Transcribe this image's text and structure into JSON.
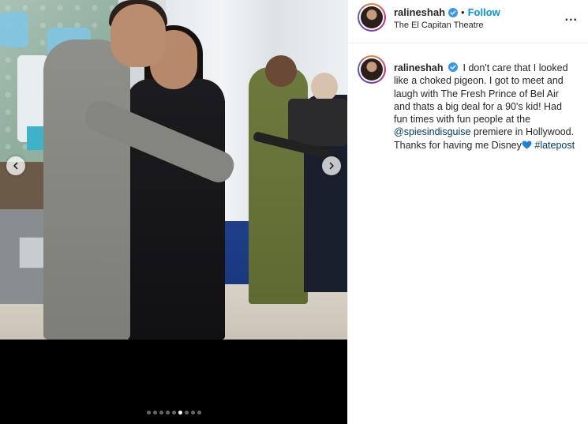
{
  "post": {
    "username": "ralineshah",
    "follow_label": "Follow",
    "separator": "•",
    "location": "The El Capitan Theatre",
    "more_label": "...",
    "caption": {
      "text_part1": "I don't care that I looked like a choked pigeon. I got to meet and laugh with The Fresh Prince of Bel Air and thats a big deal for a 90's kid! Had fun times with fun people at the",
      "mention": "@spiesindisguise",
      "text_part2": "premiere in Hollywood. Thanks for having me Disney",
      "hashtag": "#latepost"
    }
  },
  "carousel": {
    "total_slides": 9,
    "active_index": 5
  },
  "colors": {
    "link_blue": "#0095f6",
    "verified_blue": "#3897f0",
    "mention_color": "#00376b",
    "heart_blue": "#1e7fd6"
  },
  "icons": {
    "verified": "verified-badge-icon",
    "prev": "chevron-left-icon",
    "next": "chevron-right-icon",
    "heart": "blue-heart-icon"
  }
}
